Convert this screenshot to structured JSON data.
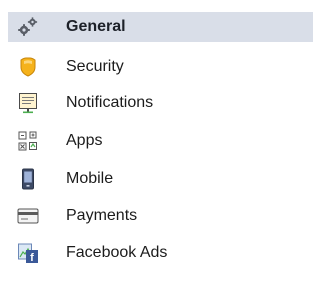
{
  "sidebar": {
    "items": [
      {
        "label": "General",
        "icon": "gear-icon",
        "active": true
      },
      {
        "label": "Security",
        "icon": "shield-icon",
        "active": false
      },
      {
        "label": "Notifications",
        "icon": "notifications-icon",
        "active": false
      },
      {
        "label": "Apps",
        "icon": "apps-icon",
        "active": false
      },
      {
        "label": "Mobile",
        "icon": "mobile-phone-icon",
        "active": false
      },
      {
        "label": "Payments",
        "icon": "credit-card-icon",
        "active": false
      },
      {
        "label": "Facebook Ads",
        "icon": "facebook-ads-icon",
        "active": false
      }
    ]
  },
  "colors": {
    "active_background": "#d9dee8",
    "text": "#1c1c1c",
    "security_shield": "#f5b21b",
    "facebook_blue": "#3b5998"
  }
}
